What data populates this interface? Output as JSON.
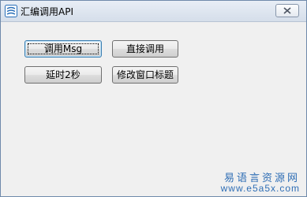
{
  "window": {
    "title": "汇编调用API",
    "icon": "app-icon",
    "close_icon": "close-icon"
  },
  "buttons": {
    "call_msg": "调用Msg",
    "direct_call": "直接调用",
    "delay_2s": "延时2秒",
    "modify_title": "修改窗口标题"
  },
  "watermark": {
    "line1": "易语言资源网",
    "line2": "www.e5a5x.com"
  },
  "colors": {
    "accent": "#2f6eb5",
    "window_bg": "#f0f0f0"
  }
}
